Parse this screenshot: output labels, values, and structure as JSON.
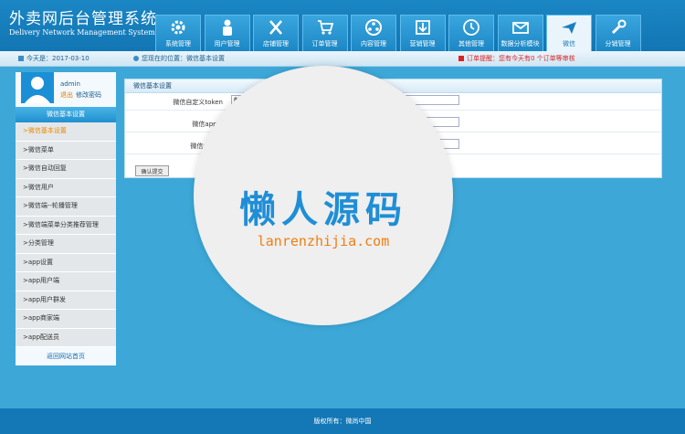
{
  "header": {
    "title": "外卖网后台管理系统",
    "subtitle": "Delivery Network Management System",
    "nav": [
      {
        "label": "系统管理",
        "icon": "gear-icon"
      },
      {
        "label": "用户管理",
        "icon": "user-icon"
      },
      {
        "label": "店铺管理",
        "icon": "tools-icon"
      },
      {
        "label": "订单管理",
        "icon": "cart-icon"
      },
      {
        "label": "内容管理",
        "icon": "film-icon"
      },
      {
        "label": "营销管理",
        "icon": "download-icon"
      },
      {
        "label": "其他管理",
        "icon": "clock-icon"
      },
      {
        "label": "数据分析模块",
        "icon": "mail-icon"
      },
      {
        "label": "微信",
        "icon": "plane-icon",
        "active": true
      },
      {
        "label": "分销管理",
        "icon": "wrench-icon"
      }
    ]
  },
  "infobar": {
    "date": "今天是：2017-03-10",
    "location": "您现在的位置：微信基本设置",
    "alert": "订单提醒：您有今天有0 个订单等审核"
  },
  "sidebar": {
    "username": "admin",
    "logout": "退出",
    "change_password": "修改密码",
    "title": "微信基本设置",
    "items": [
      {
        "label": ">微信基本设置",
        "active": true
      },
      {
        "label": ">微信菜单"
      },
      {
        "label": ">微信自动回复"
      },
      {
        "label": ">微信用户"
      },
      {
        "label": ">微信端--轮播管理"
      },
      {
        "label": ">微信端菜单分类推荐管理"
      },
      {
        "label": ">分类管理"
      },
      {
        "label": ">app设置"
      },
      {
        "label": ">app用户端"
      },
      {
        "label": ">app用户群发"
      },
      {
        "label": ">app商家端"
      },
      {
        "label": ">app配送员"
      }
    ],
    "back_home": "返回网站首页"
  },
  "panel": {
    "title": "微信基本设置",
    "fields": [
      {
        "label": "微信自定义token",
        "value": "8888"
      },
      {
        "label": "微信appid",
        "value": ""
      },
      {
        "label": "微信secret",
        "value": ""
      }
    ],
    "submit": "确认提交"
  },
  "watermark": {
    "cn": "懒人源码",
    "en": "lanrenzhijia.com"
  },
  "footer": {
    "copyright": "版权所有：微尚中国"
  },
  "colors": {
    "background": "#3da8d8",
    "header": "#1276b3",
    "accent_orange": "#e88a00",
    "alert_red": "#dd2222"
  }
}
